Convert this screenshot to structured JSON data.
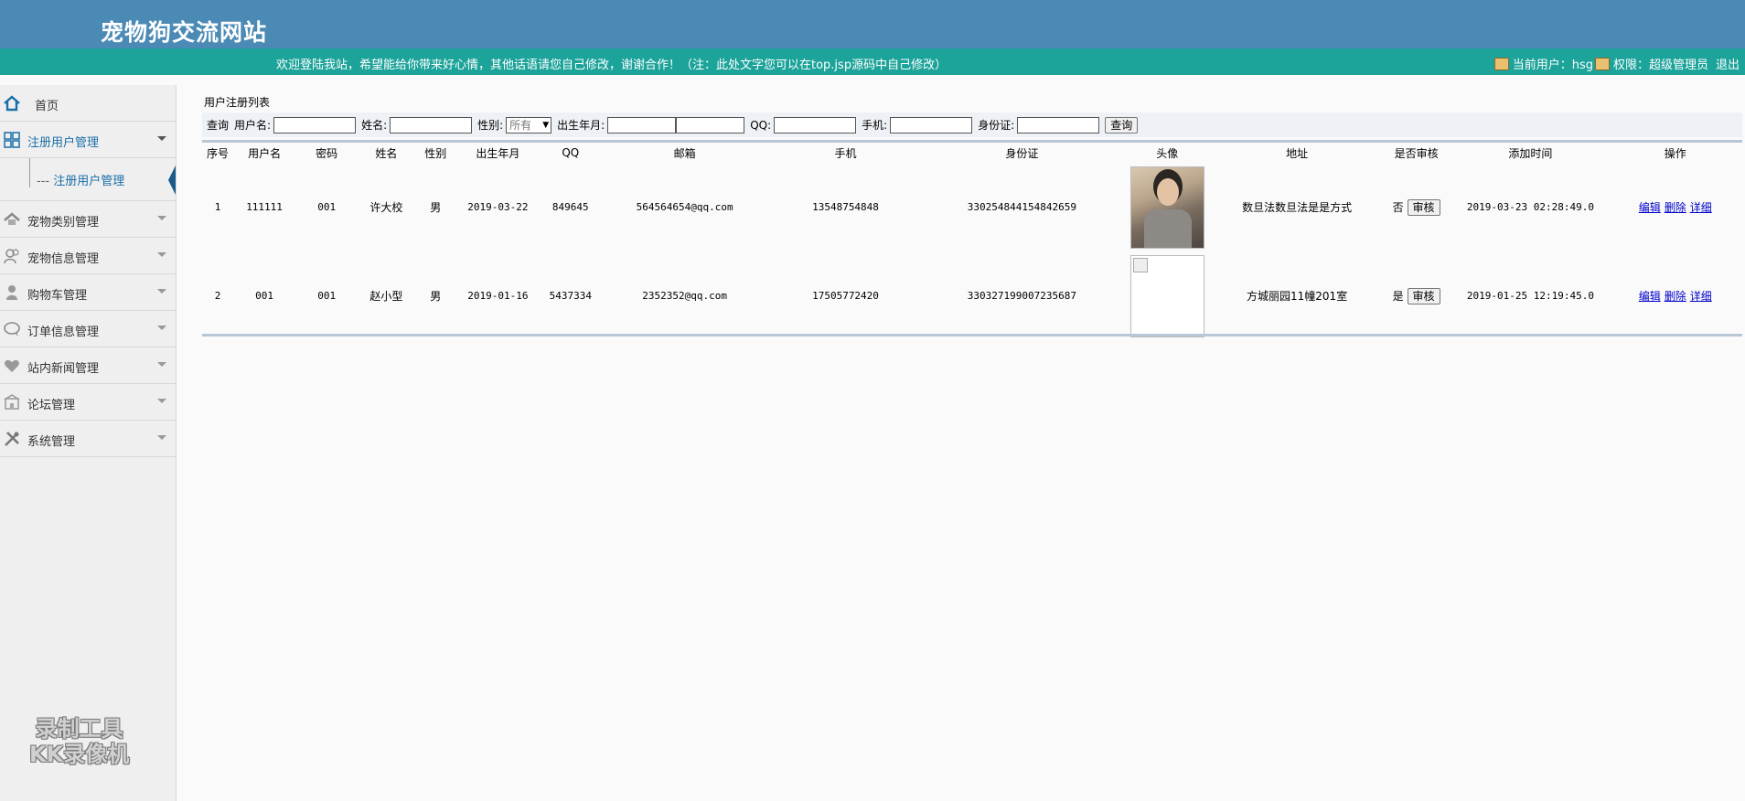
{
  "header": {
    "site_title": "宠物狗交流网站",
    "welcome": "欢迎登陆我站，希望能给你带来好心情，其他话语请您自己修改，谢谢合作！（注：此处文字您可以在top.jsp源码中自己修改）",
    "current_user": "当前用户：hsg",
    "role": "权限：超级管理员",
    "logout": "退出"
  },
  "sidebar": {
    "home": "首页",
    "items": [
      {
        "label": "注册用户管理",
        "icon": "grid-icon"
      },
      {
        "label": "宠物类别管理",
        "icon": "house-icon"
      },
      {
        "label": "宠物信息管理",
        "icon": "users-icon"
      },
      {
        "label": "购物车管理",
        "icon": "person-icon"
      },
      {
        "label": "订单信息管理",
        "icon": "chat-icon"
      },
      {
        "label": "站内新闻管理",
        "icon": "heart-icon"
      },
      {
        "label": "论坛管理",
        "icon": "building-icon"
      },
      {
        "label": "系统管理",
        "icon": "tools-icon"
      }
    ],
    "submenu": "注册用户管理"
  },
  "watermark": {
    "line1": "录制工具",
    "line2": "KK录像机"
  },
  "main": {
    "caption": "用户注册列表",
    "search": {
      "query_label": "查询",
      "username_label": "用户名:",
      "name_label": "姓名:",
      "gender_label": "性别:",
      "gender_value": "所有",
      "birth_label": "出生年月:",
      "qq_label": "QQ:",
      "phone_label": "手机:",
      "id_label": "身份证:",
      "button": "查询"
    },
    "columns": [
      "序号",
      "用户名",
      "密码",
      "姓名",
      "性别",
      "出生年月",
      "QQ",
      "邮箱",
      "手机",
      "身份证",
      "头像",
      "地址",
      "是否审核",
      "添加时间",
      "操作"
    ],
    "rows": [
      {
        "no": "1",
        "username": "111111",
        "password": "001",
        "name": "许大校",
        "gender": "男",
        "birth": "2019-03-22",
        "qq": "849645",
        "email": "564564654@qq.com",
        "phone": "13548754848",
        "idcard": "330254844154842659",
        "address": "数旦法数旦法是是方式",
        "audited": "否",
        "audit_btn": "审核",
        "added": "2019-03-23 02:28:49.0",
        "op_edit": "编辑",
        "op_delete": "删除",
        "op_detail": "详细"
      },
      {
        "no": "2",
        "username": "001",
        "password": "001",
        "name": "赵小型",
        "gender": "男",
        "birth": "2019-01-16",
        "qq": "5437334",
        "email": "2352352@qq.com",
        "phone": "17505772420",
        "idcard": "330327199007235687",
        "address": "方城丽园11幢201室",
        "audited": "是",
        "audit_btn": "审核",
        "added": "2019-01-25 12:19:45.0",
        "op_edit": "编辑",
        "op_delete": "删除",
        "op_detail": "详细"
      }
    ]
  }
}
